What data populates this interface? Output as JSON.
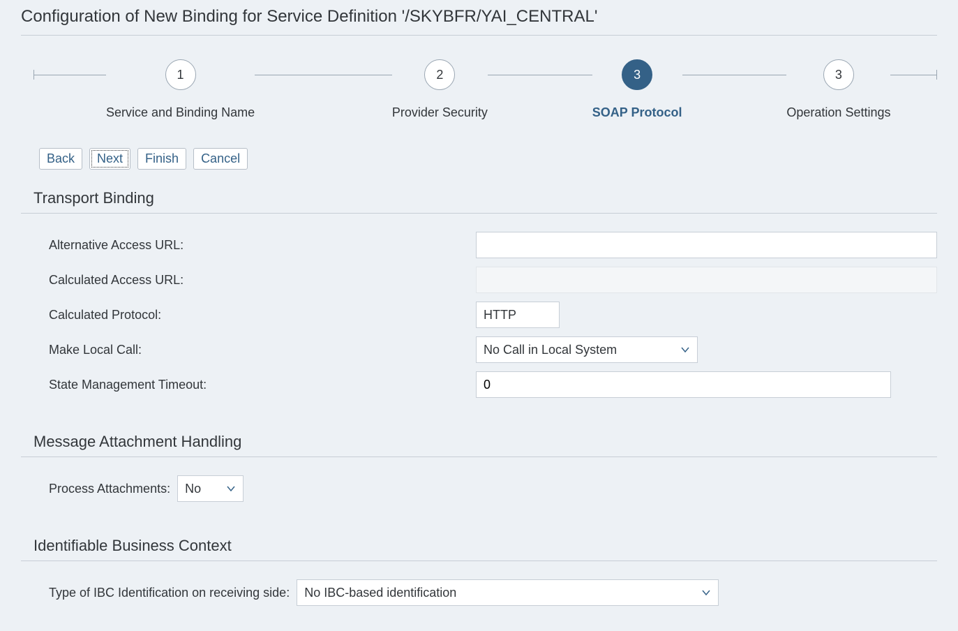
{
  "page_title": "Configuration of New Binding for Service Definition '/SKYBFR/YAI_CENTRAL'",
  "stepper": {
    "active_index": 2,
    "steps": [
      {
        "num": "1",
        "label": "Service and Binding Name"
      },
      {
        "num": "2",
        "label": "Provider Security"
      },
      {
        "num": "3",
        "label": "SOAP Protocol"
      },
      {
        "num": "3",
        "label": "Operation Settings"
      }
    ]
  },
  "buttons": {
    "back": "Back",
    "next": "Next",
    "finish": "Finish",
    "cancel": "Cancel"
  },
  "sections": {
    "transport": {
      "title": "Transport Binding",
      "alt_url_label": "Alternative Access URL:",
      "alt_url_value": "",
      "calc_url_label": "Calculated Access URL:",
      "calc_url_value": "",
      "calc_proto_label": "Calculated Protocol:",
      "calc_proto_value": "HTTP",
      "local_call_label": "Make Local Call:",
      "local_call_value": "No Call in Local System",
      "timeout_label": "State Management Timeout:",
      "timeout_value": "0"
    },
    "attach": {
      "title": "Message Attachment Handling",
      "process_label": "Process Attachments:",
      "process_value": "No"
    },
    "ibc": {
      "title": "Identifiable Business Context",
      "type_label": "Type of IBC Identification on receiving side:",
      "type_value": "No IBC-based identification"
    }
  }
}
